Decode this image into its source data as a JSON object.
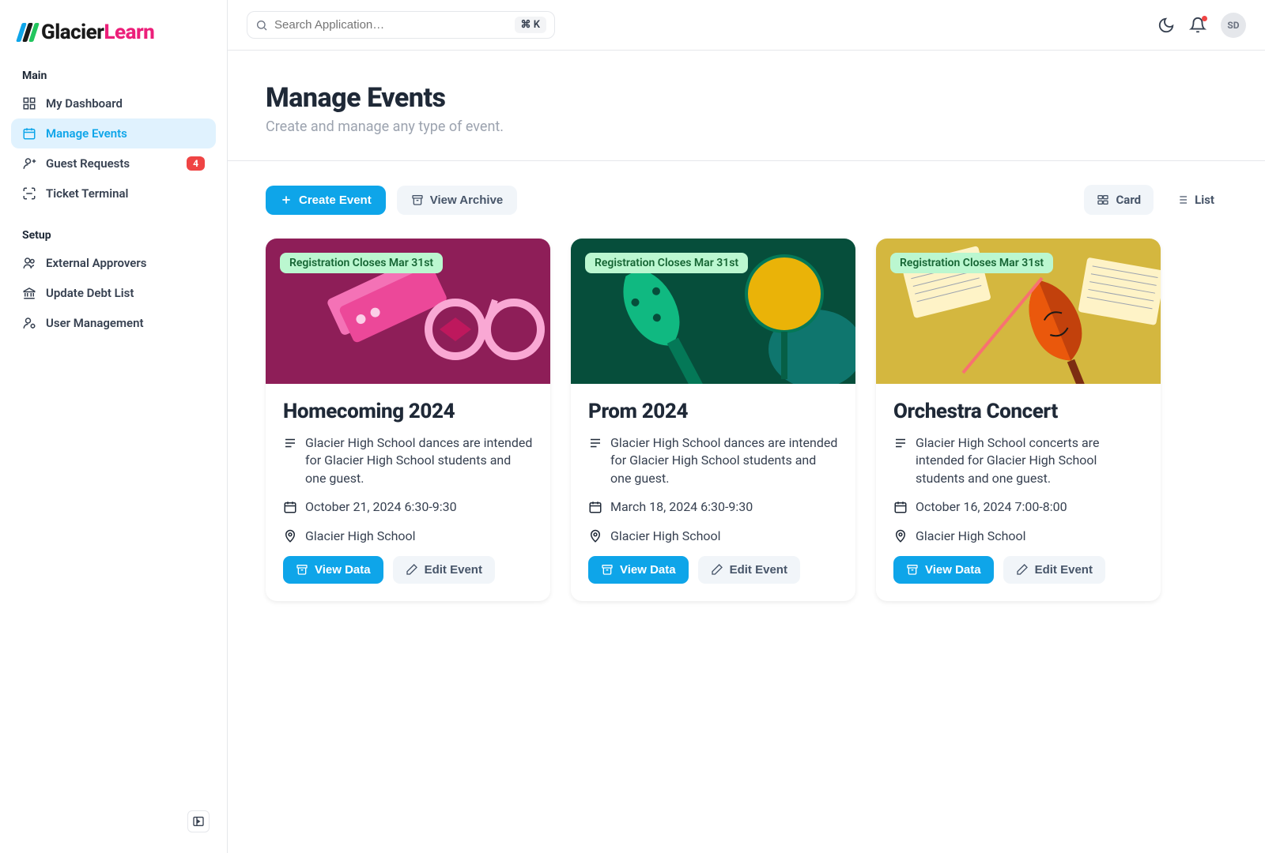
{
  "brand": {
    "primary": "Glacier",
    "secondary": "Learn"
  },
  "search": {
    "placeholder": "Search Application…",
    "shortcut": "⌘ K"
  },
  "user": {
    "initials": "SD"
  },
  "sidebar": {
    "sections": [
      {
        "label": "Main",
        "items": [
          {
            "label": "My Dashboard"
          },
          {
            "label": "Manage Events",
            "active": true
          },
          {
            "label": "Guest Requests",
            "badge": "4"
          },
          {
            "label": "Ticket Terminal"
          }
        ]
      },
      {
        "label": "Setup",
        "items": [
          {
            "label": "External Approvers"
          },
          {
            "label": "Update Debt List"
          },
          {
            "label": "User Management"
          }
        ]
      }
    ]
  },
  "page": {
    "title": "Manage Events",
    "subtitle": "Create and manage any type of event."
  },
  "toolbar": {
    "create_label": "Create Event",
    "archive_label": "View Archive",
    "view_card": "Card",
    "view_list": "List"
  },
  "events": [
    {
      "badge": "Registration Closes Mar 31st",
      "title": "Homecoming 2024",
      "description": "Glacier High School dances are intended for Glacier High School students and one guest.",
      "datetime": "October 21, 2024 6:30-9:30",
      "location": "Glacier High School",
      "view_label": "View Data",
      "edit_label": "Edit Event",
      "theme": "pink"
    },
    {
      "badge": "Registration Closes Mar 31st",
      "title": "Prom 2024",
      "description": "Glacier High School dances are intended for Glacier High School students and one guest.",
      "datetime": "March 18, 2024 6:30-9:30",
      "location": "Glacier High School",
      "view_label": "View Data",
      "edit_label": "Edit Event",
      "theme": "green"
    },
    {
      "badge": "Registration Closes Mar 31st",
      "title": "Orchestra Concert",
      "description": "Glacier High School concerts are intended for Glacier High School students and one guest.",
      "datetime": "October 16, 2024 7:00-8:00",
      "location": "Glacier High School",
      "view_label": "View Data",
      "edit_label": "Edit Event",
      "theme": "gold"
    }
  ]
}
